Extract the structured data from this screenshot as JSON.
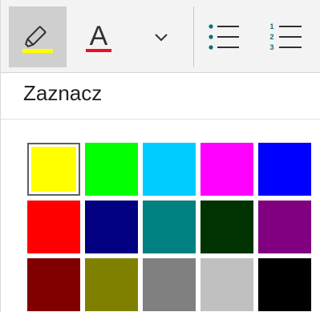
{
  "toolbar": {
    "highlighter": {
      "icon": "highlighter-icon",
      "underline_color": "#ffff00"
    },
    "font_color": {
      "glyph": "A",
      "underline_color": "#e81123"
    },
    "dropdown": {
      "icon": "chevron-down-icon"
    },
    "bullets": {
      "icon": "bulleted-list-icon",
      "accent": "#0f6e7a"
    },
    "numbering": {
      "icon": "numbered-list-icon",
      "numbers": [
        "1",
        "2",
        "3"
      ],
      "accent": "#0f6e7a"
    }
  },
  "panel": {
    "title": "Zaznacz"
  },
  "colors": {
    "selected_index": 0,
    "swatches": [
      "#ffff00",
      "#00ff00",
      "#00ccff",
      "#ff00ff",
      "#0000ff",
      "#ff0000",
      "#000080",
      "#008080",
      "#003300",
      "#800080",
      "#800000",
      "#808000",
      "#808080",
      "#c0c0c0",
      "#000000"
    ]
  }
}
